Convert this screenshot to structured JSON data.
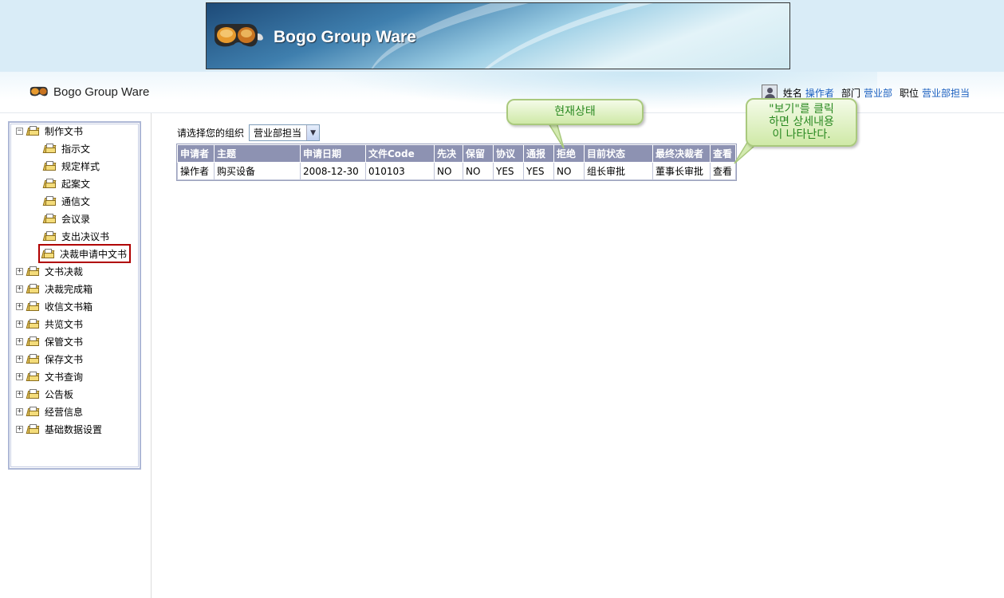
{
  "banner": {
    "title": "Bogo Group Ware",
    "icon": "goggles-icon"
  },
  "header": {
    "logo_text": "Bogo Group Ware",
    "name_label": "姓名",
    "name_value": "操作者",
    "dept_label": "部门",
    "dept_value": "营业部",
    "position_label": "职位",
    "position_value": "营业部担当"
  },
  "sidebar": {
    "items": [
      {
        "label": "制作文书",
        "toggle": "−",
        "expanded": true,
        "children": [
          "指示文",
          "规定样式",
          "起案文",
          "通信文",
          "会议录",
          "支出决议书",
          "决裁申请中文书"
        ]
      },
      {
        "label": "文书决裁",
        "toggle": "+"
      },
      {
        "label": "决裁完成箱",
        "toggle": "+"
      },
      {
        "label": "收信文书箱",
        "toggle": "+"
      },
      {
        "label": "共览文书",
        "toggle": "+"
      },
      {
        "label": "保管文书",
        "toggle": "+"
      },
      {
        "label": "保存文书",
        "toggle": "+"
      },
      {
        "label": "文书查询",
        "toggle": "+"
      },
      {
        "label": "公告板",
        "toggle": "+"
      },
      {
        "label": "经营信息",
        "toggle": "+"
      },
      {
        "label": "基础数据设置",
        "toggle": "+"
      }
    ]
  },
  "main": {
    "org_label": "请选择您的组织",
    "org_selected": "营业部担当",
    "table": {
      "headers": [
        "申请者",
        "主题",
        "申请日期",
        "文件Code",
        "先决",
        "保留",
        "协议",
        "通报",
        "拒绝",
        "目前状态",
        "最终决裁者",
        "查看"
      ],
      "rows": [
        [
          "操作者",
          "购买设备",
          "2008-12-30",
          "010103",
          "NO",
          "NO",
          "YES",
          "YES",
          "NO",
          "组长审批",
          "董事长审批",
          "查看"
        ]
      ]
    }
  },
  "callouts": {
    "status": "현재상태",
    "view_line1": "\"보기\"를 클릭",
    "view_line2": "하면 상세내용",
    "view_line3": "이 나타난다."
  },
  "colors": {
    "header_bg": "#8d92b2",
    "link_blue": "#1a5fbf",
    "callout_green": "#2b8a22",
    "selected_border": "#b00000"
  }
}
